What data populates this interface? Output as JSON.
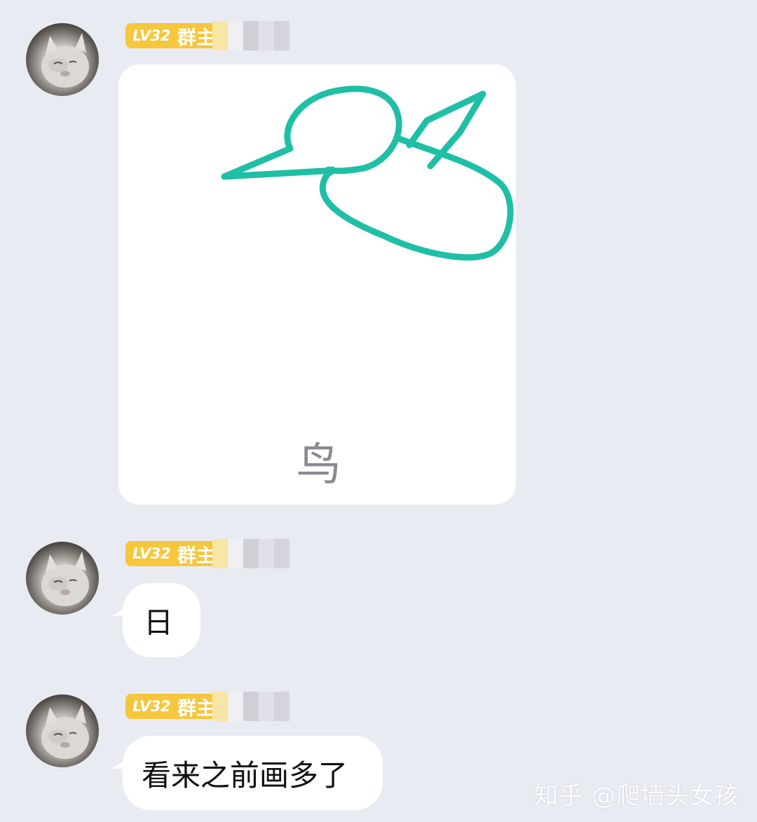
{
  "messages": [
    {
      "sender": {
        "level": "LV32",
        "role": "群主"
      },
      "type": "drawing",
      "drawing": {
        "caption": "鸟",
        "stroke_color": "#1fbfa6",
        "icon": "bird-doodle-icon"
      }
    },
    {
      "sender": {
        "level": "LV32",
        "role": "群主"
      },
      "type": "text",
      "text": "日"
    },
    {
      "sender": {
        "level": "LV32",
        "role": "群主"
      },
      "type": "text",
      "text": "看来之前画多了"
    }
  ],
  "watermark": {
    "text": "知乎 @爬墙头女孩"
  },
  "colors": {
    "background": "#e9ebf3",
    "badge": "#f6c73d",
    "bubble": "#ffffff",
    "stroke": "#1fbfa6"
  }
}
